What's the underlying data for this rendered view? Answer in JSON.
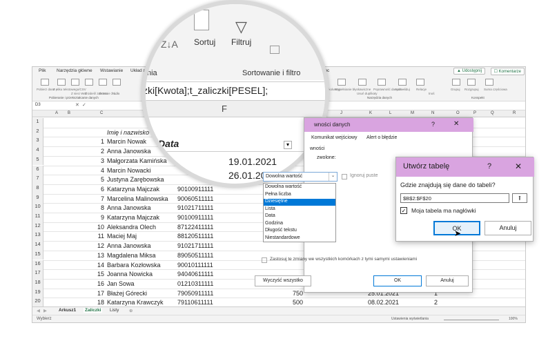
{
  "ribbon": {
    "tabs": [
      "Plik",
      "Narzędzia główne",
      "Wstawianie",
      "Układ s",
      "Pomoc"
    ],
    "share_label": "Udostępnij",
    "comments_label": "Komentarze",
    "left_items": [
      "Pobierz dane ~",
      "Z pliku tekstowego/CSV",
      "Z sieci Web",
      "Z tabeli/ zakresu",
      "Ostatnie źródła",
      "Is..."
    ],
    "left_group_label": "Pobieranie i przekształcanie danych",
    "right_items": [
      "Tekst jako kolumny",
      "Wypełnianie błyskawiczne",
      "Usuń duplikaty",
      "Poprawność danych ~",
      "Konsoliduj",
      "Relacje",
      "Grupuj",
      "Rozgrupuj",
      "Suma częściowa"
    ],
    "data_tools_label": "Narzędzia danych",
    "outline_label": "Konspekt",
    "mid_text": "tnoś"
  },
  "formula_bar": {
    "name_box": "D3",
    "formula": "=ADR.POŚR(\"t_zaliczki[Kwota];t_zaliczki[PESEL];"
  },
  "magnifier": {
    "sort_label": "Sortuj",
    "filter_label": "Filtruj",
    "group_label": "Sortowanie i filtro",
    "zoomed_formula": "zki[Kwota];t_zaliczki[PESEL];",
    "ia_text": "nia",
    "col_f": "F",
    "date_header": "Data",
    "dates": [
      "19.01.2021",
      "26.01.2021"
    ],
    "sa_text": "sa"
  },
  "columns": [
    "A",
    "B",
    "C",
    "D",
    "E",
    "F",
    "G",
    "H",
    "I",
    "J",
    "K",
    "L",
    "M",
    "N",
    "O",
    "P",
    "Q",
    "R"
  ],
  "header_row": {
    "num": "",
    "name": "Imię i nazwisko"
  },
  "rows": [
    {
      "r": "1",
      "num": "",
      "name": "",
      "pesel": "",
      "kw": "",
      "date": "",
      "x": ""
    },
    {
      "r": "2",
      "num": "",
      "name": "Imię i nazwisko",
      "pesel": "",
      "kw": "",
      "date": "",
      "x": ""
    },
    {
      "r": "3",
      "num": "1",
      "name": "Marcin Nowak",
      "pesel": "",
      "kw": "",
      "date": "",
      "x": ""
    },
    {
      "r": "4",
      "num": "2",
      "name": "Anna Janowska",
      "pesel": "",
      "kw": "",
      "date": "",
      "x": ""
    },
    {
      "r": "5",
      "num": "3",
      "name": "Małgorzata Kamińska",
      "pesel": "",
      "kw": "",
      "date": "",
      "x": ""
    },
    {
      "r": "6",
      "num": "4",
      "name": "Marcin Nowacki",
      "pesel": "",
      "kw": "",
      "date": "",
      "x": ""
    },
    {
      "r": "7",
      "num": "5",
      "name": "Justyna Zarębowska",
      "pesel": "",
      "kw": "",
      "date": "",
      "x": ""
    },
    {
      "r": "8",
      "num": "6",
      "name": "Katarzyna Majczak",
      "pesel": "90100911111",
      "kw": "",
      "date": "",
      "x": ""
    },
    {
      "r": "9",
      "num": "7",
      "name": "Marcelina Malinowska",
      "pesel": "90060511111",
      "kw": "",
      "date": "",
      "x": ""
    },
    {
      "r": "10",
      "num": "8",
      "name": "Anna Janowska",
      "pesel": "91021711111",
      "kw": "",
      "date": "",
      "x": ""
    },
    {
      "r": "11",
      "num": "9",
      "name": "Katarzyna Majczak",
      "pesel": "90100911111",
      "kw": "",
      "date": "",
      "x": ""
    },
    {
      "r": "12",
      "num": "10",
      "name": "Aleksandra Olech",
      "pesel": "87122411111",
      "kw": "",
      "date": "",
      "x": ""
    },
    {
      "r": "13",
      "num": "11",
      "name": "Maciej Maj",
      "pesel": "88120511111",
      "kw": "",
      "date": "",
      "x": ""
    },
    {
      "r": "14",
      "num": "12",
      "name": "Anna Janowska",
      "pesel": "91021711111",
      "kw": "",
      "date": "",
      "x": ""
    },
    {
      "r": "15",
      "num": "13",
      "name": "Magdalena Miksa",
      "pesel": "89050511111",
      "kw": "",
      "date": "",
      "x": ""
    },
    {
      "r": "16",
      "num": "14",
      "name": "Barbara Kozłowska",
      "pesel": "90010111111",
      "kw": "",
      "date": "",
      "x": ""
    },
    {
      "r": "17",
      "num": "15",
      "name": "Joanna Nowicka",
      "pesel": "94040611111",
      "kw": "",
      "date": "",
      "x": ""
    },
    {
      "r": "18",
      "num": "16",
      "name": "Jan Sowa",
      "pesel": "01210311111",
      "kw": "",
      "date": "",
      "x": ""
    },
    {
      "r": "19",
      "num": "17",
      "name": "Błażej Górecki",
      "pesel": "79050911111",
      "kw": "750",
      "date": "25.01.2021",
      "x": "1"
    },
    {
      "r": "20",
      "num": "18",
      "name": "Katarzyna Krawczyk",
      "pesel": "79110611111",
      "kw": "500",
      "date": "08.02.2021",
      "x": "2"
    }
  ],
  "sheet_tabs": [
    "Arkusz1",
    "Zaliczki",
    "Listy"
  ],
  "status": {
    "left": "Wybierz",
    "display_settings": "Ustawienia wyświetlania",
    "zoom": "100%"
  },
  "validation_dialog": {
    "title": "wności danych",
    "tabs": [
      "Komunikat wejściowy",
      "Alert o błędzie"
    ],
    "criteria_label": "wności",
    "allow_label": "zwolone:",
    "selected_value": "Dowolna wartość",
    "ignore_blank": "Ignoruj puste",
    "options": [
      "Dowolna wartość",
      "Pełna liczba",
      "Dziesiętne",
      "Lista",
      "Data",
      "Godzina",
      "Długość tekstu",
      "Niestandardowe"
    ],
    "highlighted_option": "Dziesiętne",
    "apply_all": "Zastosuj te zmiany we wszystkich komórkach z tymi samymi ustawieniami",
    "clear_all": "Wyczyść wszystko",
    "ok": "OK",
    "cancel": "Anuluj",
    "help": "?",
    "close": "✕"
  },
  "create_table_dialog": {
    "title": "Utwórz tabelę",
    "help": "?",
    "close": "✕",
    "question": "Gdzie znajdują się dane do tabeli?",
    "range": "$B$2:$F$20",
    "has_headers": "Moja tabela ma nagłówki",
    "ok": "OK",
    "cancel": "Anuluj"
  },
  "colors": {
    "accent": "#d9a4e0",
    "excel_green": "#217346",
    "highlight": "#0078d7"
  }
}
